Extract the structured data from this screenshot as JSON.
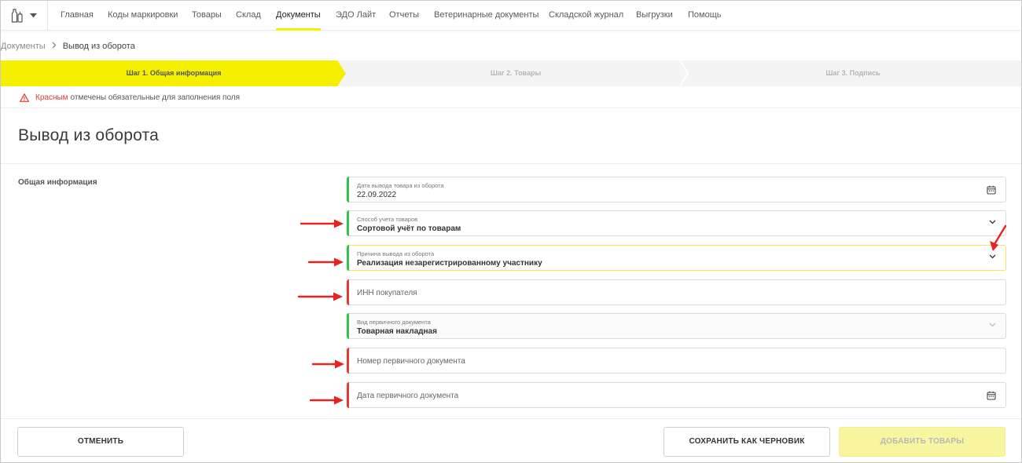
{
  "nav": {
    "items": [
      {
        "label": "Главная"
      },
      {
        "label": "Коды маркировки"
      },
      {
        "label": "Товары"
      },
      {
        "label": "Склад"
      },
      {
        "label": "Документы",
        "active": true
      },
      {
        "label": "ЭДО Лайт"
      },
      {
        "label": "Отчеты"
      },
      {
        "label": "Ветеринарные документы"
      },
      {
        "label": "Складской журнал"
      },
      {
        "label": "Выгрузки"
      },
      {
        "label": "Помощь"
      }
    ],
    "logo_icon": "bottles-icon",
    "dropdown_icon": "caret-down-icon"
  },
  "breadcrumb": {
    "parent": "Документы",
    "current": "Вывод из оборота"
  },
  "steps": [
    {
      "label": "Шаг 1. Общая информация",
      "state": "active"
    },
    {
      "label": "Шаг 2. Товары",
      "state": "inactive"
    },
    {
      "label": "Шаг 3. Подпись",
      "state": "inactive"
    }
  ],
  "notice": {
    "highlight": "Красным",
    "text": "отмечены обязательные для заполнения поля"
  },
  "page_title": "Вывод из оборота",
  "section_label": "Общая информация",
  "fields": {
    "withdrawal_date": {
      "label": "Дата вывода товара из оборота",
      "value": "22.09.2022"
    },
    "accounting_method": {
      "label": "Способ учета товаров",
      "value": "Сортовой учёт по товарам"
    },
    "withdrawal_reason": {
      "label": "Причина вывода из оборота",
      "value": "Реализация незарегистрированному участнику"
    },
    "buyer_inn": {
      "placeholder": "ИНН покупателя"
    },
    "primary_doc_type": {
      "label": "Вид первичного документа",
      "value": "Товарная накладная"
    },
    "primary_doc_number": {
      "placeholder": "Номер первичного документа"
    },
    "primary_doc_date": {
      "placeholder": "Дата первичного документа"
    }
  },
  "footer": {
    "cancel": "ОТМЕНИТЬ",
    "save_draft": "СОХРАНИТЬ КАК ЧЕРНОВИК",
    "add_goods": "ДОБАВИТЬ ТОВАРЫ"
  },
  "colors": {
    "accent_yellow": "#f5f000",
    "required_red": "#e53935",
    "filled_green": "#32c24d",
    "annotation_arrow": "#e8231d"
  }
}
